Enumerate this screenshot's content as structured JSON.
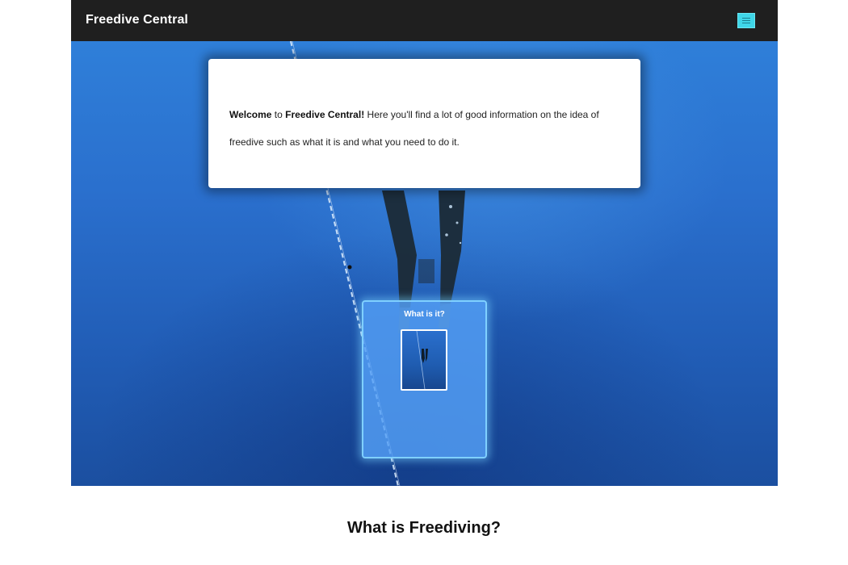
{
  "navbar": {
    "brand": "Freedive Central",
    "menu_toggle_color": "#3fd6e8",
    "background_color": "#1f1f1f",
    "menu_icon": "hamburger-menu-icon"
  },
  "hero": {
    "background_color": "#2a6fcd",
    "welcome": {
      "prefix": "Welcome",
      "to": " to ",
      "site_name": "Freedive Central!",
      "body": " Here you'll find a lot of good information on the idea of freedive such as what it is and what you need to do it."
    },
    "info_card": {
      "title": "What is it?",
      "accent_color": "#7fd0ff"
    }
  },
  "main": {
    "section_heading": "What is Freediving?"
  }
}
